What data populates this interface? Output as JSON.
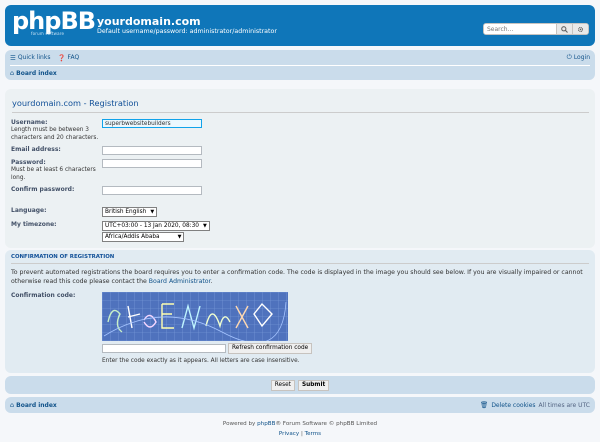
{
  "header": {
    "logo_text": "phpBB",
    "logo_sub": "forum software",
    "site_title": "yourdomain.com",
    "site_desc": "Default username/password: administrator/administrator",
    "search_placeholder": "Search…"
  },
  "navbar": {
    "quick_links": "Quick links",
    "faq": "FAQ",
    "login": "Login",
    "board_index": "Board index"
  },
  "form": {
    "title": "yourdomain.com - Registration",
    "username_label": "Username:",
    "username_hint": "Length must be between 3 characters and 20 characters.",
    "username_value": "superbwebsitebuilders",
    "email_label": "Email address:",
    "email_value": "",
    "password_label": "Password:",
    "password_hint": "Must be at least 6 characters long.",
    "password_value": "",
    "confirm_label": "Confirm password:",
    "confirm_value": "",
    "language_label": "Language:",
    "language_value": "British English",
    "timezone_label": "My timezone:",
    "timezone_value": "UTC+03:00 - 13 Jan 2020, 08:30",
    "timezone_region": "Africa/Addis Ababa"
  },
  "confirmation": {
    "title": "CONFIRMATION OF REGISTRATION",
    "explain_pre": "To prevent automated registrations the board requires you to enter a confirmation code. The code is displayed in the image you should see below. If you are visually impaired or cannot otherwise read this code please contact the ",
    "explain_link": "Board Administrator",
    "explain_post": ".",
    "code_label": "Confirmation code:",
    "code_value": "",
    "refresh_button": "Refresh confirmation code",
    "code_hint": "Enter the code exactly as it appears. All letters are case insensitive."
  },
  "buttons": {
    "reset": "Reset",
    "submit": "Submit"
  },
  "footer": {
    "board_index": "Board index",
    "delete_cookies": "Delete cookies",
    "timezone_note": "All times are UTC",
    "powered_pre": "Powered by ",
    "powered_link": "phpBB",
    "powered_post": "® Forum Software © phpBB Limited",
    "privacy": "Privacy",
    "separator": "|",
    "terms": "Terms"
  },
  "colors": {
    "header": "#0f76b9",
    "navbar": "#cadceb",
    "panel": "#ecf1f3",
    "link": "#105289"
  }
}
